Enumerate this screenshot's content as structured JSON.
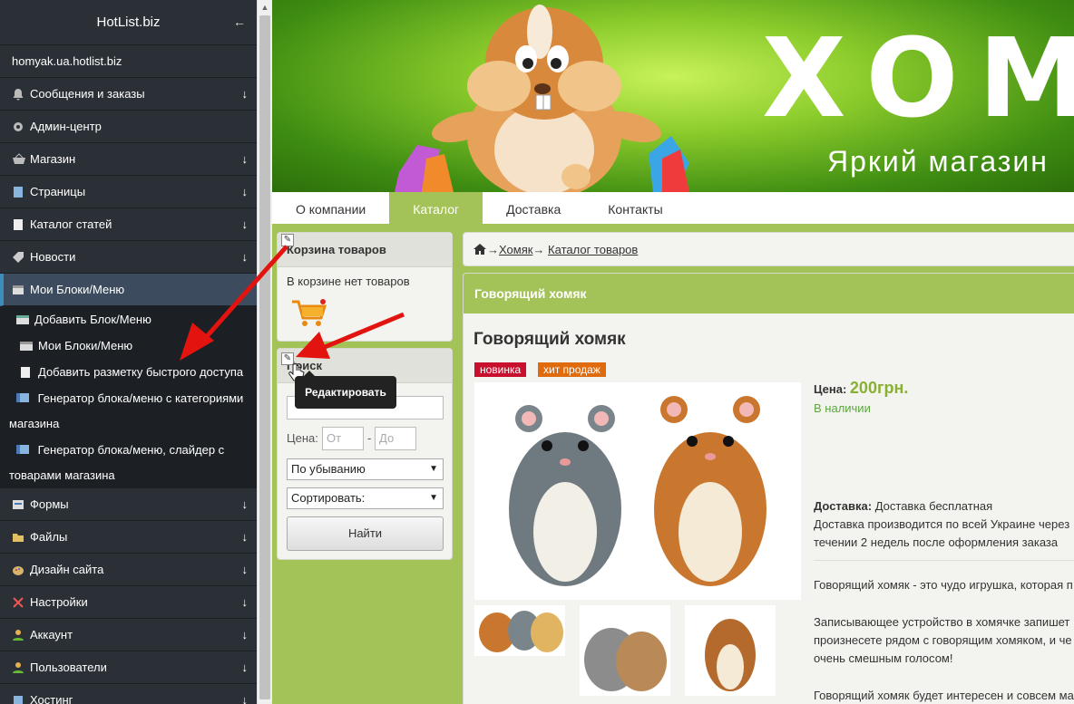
{
  "sidebar": {
    "title": "HotList.biz",
    "collapse_icon": "←",
    "domain": "homyak.ua.hotlist.biz",
    "items": [
      {
        "label": "Сообщения и заказы",
        "icon": "bell-icon",
        "arrow": "↓"
      },
      {
        "label": "Админ-центр",
        "icon": "gear-icon",
        "arrow": ""
      },
      {
        "label": "Магазин",
        "icon": "basket-icon",
        "arrow": "↓"
      },
      {
        "label": "Страницы",
        "icon": "page-icon",
        "arrow": "↓"
      },
      {
        "label": "Каталог статей",
        "icon": "document-icon",
        "arrow": "↓"
      },
      {
        "label": "Новости",
        "icon": "tag-icon",
        "arrow": "↓"
      },
      {
        "label": "Мои Блоки/Меню",
        "icon": "blocks-icon",
        "arrow": ""
      }
    ],
    "subitems": [
      {
        "label": "Добавить Блок/Меню"
      },
      {
        "label": "Мои Блоки/Меню"
      },
      {
        "label": "Добавить разметку быстрого доступа"
      },
      {
        "label": "Генератор блока/меню с категориями магазина"
      },
      {
        "label": "Генератор блока/меню, слайдер с товарами магазина"
      }
    ],
    "items_after": [
      {
        "label": "Формы",
        "icon": "form-icon",
        "arrow": "↓"
      },
      {
        "label": "Файлы",
        "icon": "folder-icon",
        "arrow": "↓"
      },
      {
        "label": "Дизайн сайта",
        "icon": "palette-icon",
        "arrow": "↓"
      },
      {
        "label": "Настройки",
        "icon": "tools-icon",
        "arrow": "↓"
      },
      {
        "label": "Аккаунт",
        "icon": "user-icon",
        "arrow": "↓"
      },
      {
        "label": "Пользователи",
        "icon": "users-icon",
        "arrow": "↓"
      },
      {
        "label": "Хостинг",
        "icon": "hosting-icon",
        "arrow": "↓"
      }
    ]
  },
  "banner": {
    "logo": "ХОМ",
    "slogan": "Яркий магазин"
  },
  "topnav": [
    "О компании",
    "Каталог",
    "Доставка",
    "Контакты"
  ],
  "cart": {
    "title": "Корзина товаров",
    "empty_text": "В корзине нет товаров"
  },
  "search": {
    "title": "Поиск",
    "price_label": "Цена:",
    "from_placeholder": "От",
    "dash": "-",
    "to_placeholder": "До",
    "order_select": "По убыванию",
    "sort_select": "Сортировать:",
    "button": "Найти"
  },
  "tooltip": "Редактировать",
  "breadcrumb": {
    "arrow": "→",
    "home": "Хомяк",
    "catalog": "Каталог товаров"
  },
  "product": {
    "header": "Говорящий хомяк",
    "title": "Говорящий хомяк",
    "badge_new": "новинка",
    "badge_hit": "хит продаж",
    "price_label": "Цена:",
    "price_value": "200грн.",
    "stock": "В наличии",
    "delivery_label": "Доставка:",
    "delivery_value": "Доставка бесплатная",
    "delivery_line2": "Доставка производится по всей Украине через",
    "delivery_line3": "течении 2 недель после оформления заказа",
    "desc1": "Говорящий хомяк - это чудо игрушка, которая п",
    "desc2": "Записывающее устройство в хомячке запишет",
    "desc3": "произнесете рядом с говорящим хомяком, и че",
    "desc4": "очень смешным голосом!",
    "desc5": "Говорящий хомяк будет интересен и совсем ма"
  },
  "colors": {
    "accent_green": "#a3c257",
    "sidebar_bg": "#2b3036",
    "badge_new": "#c8102e",
    "badge_hit": "#e06b0c",
    "arrow_red": "#e3130f"
  }
}
